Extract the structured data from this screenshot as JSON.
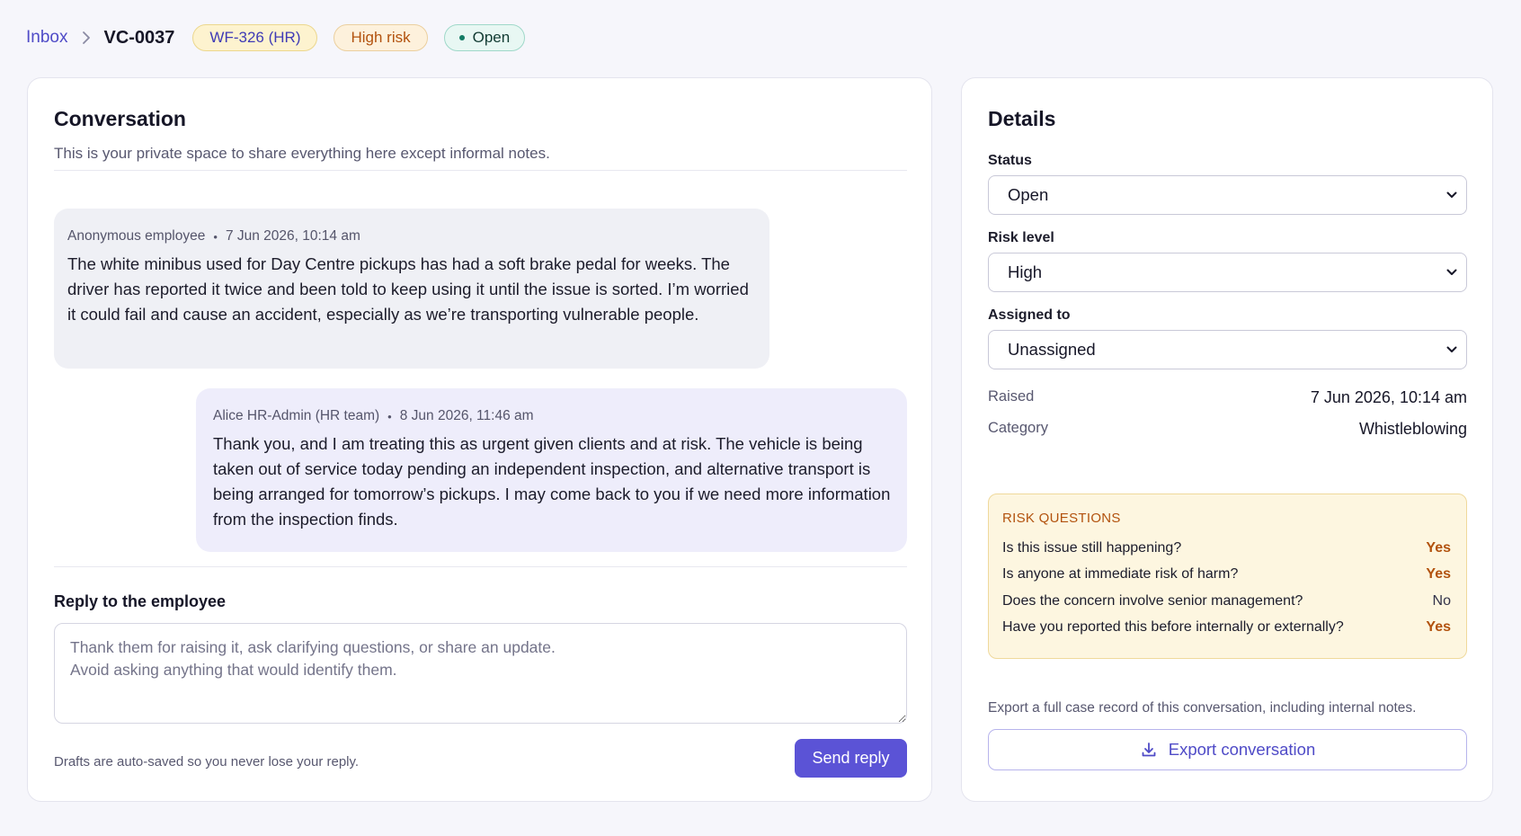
{
  "breadcrumb": {
    "inbox_label": "Inbox",
    "case_id": "VC-0037"
  },
  "badges": {
    "workflow": "WF-326 (HR)",
    "risk": "High risk",
    "status": "Open"
  },
  "conversation": {
    "title": "Conversation",
    "subtitle": "This is your private space to share everything here except informal notes.",
    "messages": [
      {
        "author": "Anonymous employee",
        "timestamp": "7 Jun 2026, 10:14 am",
        "text": "The white minibus used for Day Centre pickups has had a soft brake pedal for weeks. The driver has reported it twice and been told to keep using it until the issue is sorted. I’m worried it could fail and cause an accident, especially as we’re transporting vulnerable people."
      },
      {
        "author": "Alice HR-Admin (HR team)",
        "timestamp": "8 Jun 2026, 11:46 am",
        "text": "Thank you, and I am treating this as urgent given clients and at risk. The vehicle is being taken out of service today pending an independent inspection, and alternative transport is being arranged for tomorrow’s pickups. I may come back to you if we need more information from the inspection finds."
      }
    ],
    "reply_label": "Reply to the employee",
    "reply_placeholder": "Thank them for raising it, ask clarifying questions, or share an update.\nAvoid asking anything that would identify them.",
    "drafts_note": "Drafts are auto-saved so you never lose your reply.",
    "send_label": "Send reply"
  },
  "details": {
    "title": "Details",
    "status_label": "Status",
    "status_value": "Open",
    "risk_label": "Risk level",
    "risk_value": "High",
    "assigned_label": "Assigned to",
    "assigned_value": "Unassigned",
    "raised_label": "Raised",
    "raised_value": "7 Jun 2026, 10:14 am",
    "category_label": "Category",
    "category_value": "Whistleblowing",
    "risk_questions_title": "RISK QUESTIONS",
    "risk_questions": [
      {
        "q": "Is this issue still happening?",
        "a": "Yes"
      },
      {
        "q": "Is anyone at immediate risk of harm?",
        "a": "Yes"
      },
      {
        "q": "Does the concern involve senior management?",
        "a": "No"
      },
      {
        "q": "Have you reported this before internally or externally?",
        "a": "Yes"
      }
    ],
    "export_note": "Export a full case record of this conversation, including internal notes.",
    "export_label": "Export conversation"
  },
  "colors": {
    "accent": "#5b53d6",
    "link": "#4f4bc7",
    "risk_orange": "#b2520e",
    "open_green": "#127b64"
  },
  "icons": {
    "breadcrumb_separator": "chevron-right-icon",
    "select_arrow": "chevron-down-icon",
    "export": "download-icon",
    "status_dot": "status-dot-icon"
  }
}
